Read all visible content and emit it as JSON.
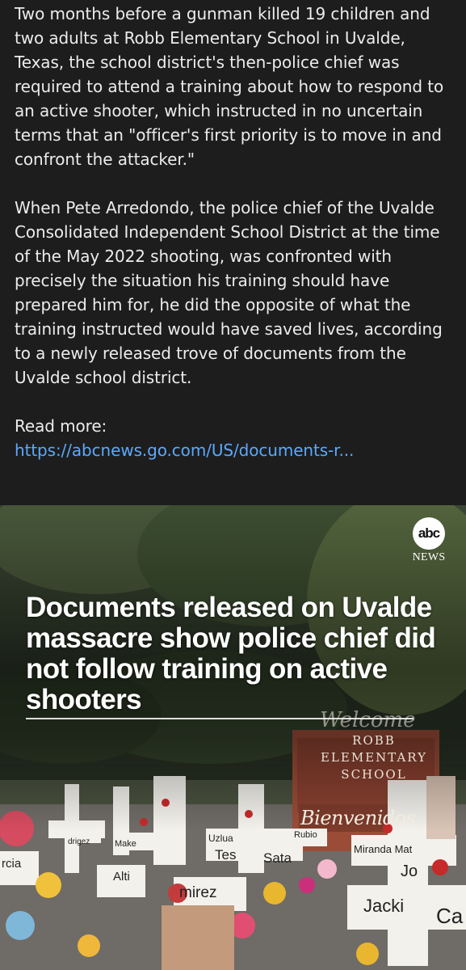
{
  "post": {
    "paragraph_1": "Two months before a gunman killed 19 children and two adults at Robb Elementary School in Uvalde, Texas, the school district's then-police chief was required to attend a training about how to respond to an active shooter, which instructed in no uncertain terms that an \"officer's first priority is to move in and confront the attacker.\"",
    "paragraph_2": "When Pete Arredondo, the police chief of the Uvalde Consolidated Independent School District at the time of the May 2022 shooting, was confronted with precisely the situation his training should have prepared him for, he did the opposite of what the training instructed would have saved lives, according to a newly released trove of documents from the Uvalde school district.",
    "read_more_label": "Read more:",
    "read_more_link": "https://abcnews.go.com/US/documents-r..."
  },
  "media": {
    "logo_abc": "abc",
    "logo_news": "NEWS",
    "headline": "Documents released on Uvalde massacre show police chief did not follow training on active shooters",
    "sign_welcome": "Welcome",
    "sign_lines": [
      "ROBB",
      "ELEMENTARY",
      "SCHOOL"
    ],
    "sign_bienvenidos": "Bienvenidos",
    "cross_names": [
      "Uzlua",
      "Tes",
      "Sata",
      "Rubio",
      "Miranda Mat",
      "Jo",
      "Jacki",
      "Ca",
      "Alti",
      "mirez",
      "rcia",
      "Make",
      "drigez"
    ]
  },
  "colors": {
    "background": "#1d1d1d",
    "text": "#ececec",
    "link": "#5aa9ff"
  }
}
